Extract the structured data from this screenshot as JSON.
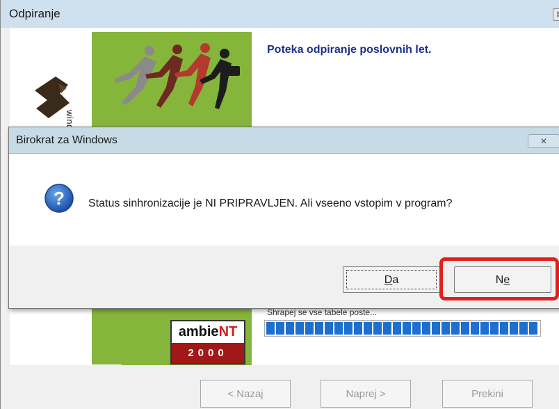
{
  "background_window": {
    "title": "Odpiranje",
    "close_glyph": "⊠",
    "heading": "Poteka odpiranje poslovnih let.",
    "windows_label": "windows",
    "progress_label": "Shrapej se vse tabele poste...",
    "progress_fraction": 1.0,
    "ambient_logo": {
      "text_left": "ambie",
      "text_right": "NT",
      "year": "2000"
    },
    "buttons": {
      "back": "< Nazaj",
      "next": "Naprej >",
      "cancel": "Prekini"
    }
  },
  "dialog": {
    "title": "Birokrat za Windows",
    "close_glyph": "✕",
    "icon": "question-icon",
    "message": "Status sinhronizacije je NI PRIPRAVLJEN. Ali vseeno vstopim v program?",
    "buttons": {
      "yes": {
        "mnemonic": "D",
        "rest": "a"
      },
      "no": {
        "lead": "N",
        "mnemonic": "e"
      }
    }
  },
  "colors": {
    "accent_green": "#86b53b",
    "highlight_red": "#e0201c",
    "heading_blue": "#1a2f8c",
    "progress_blue": "#1e6fcf"
  }
}
